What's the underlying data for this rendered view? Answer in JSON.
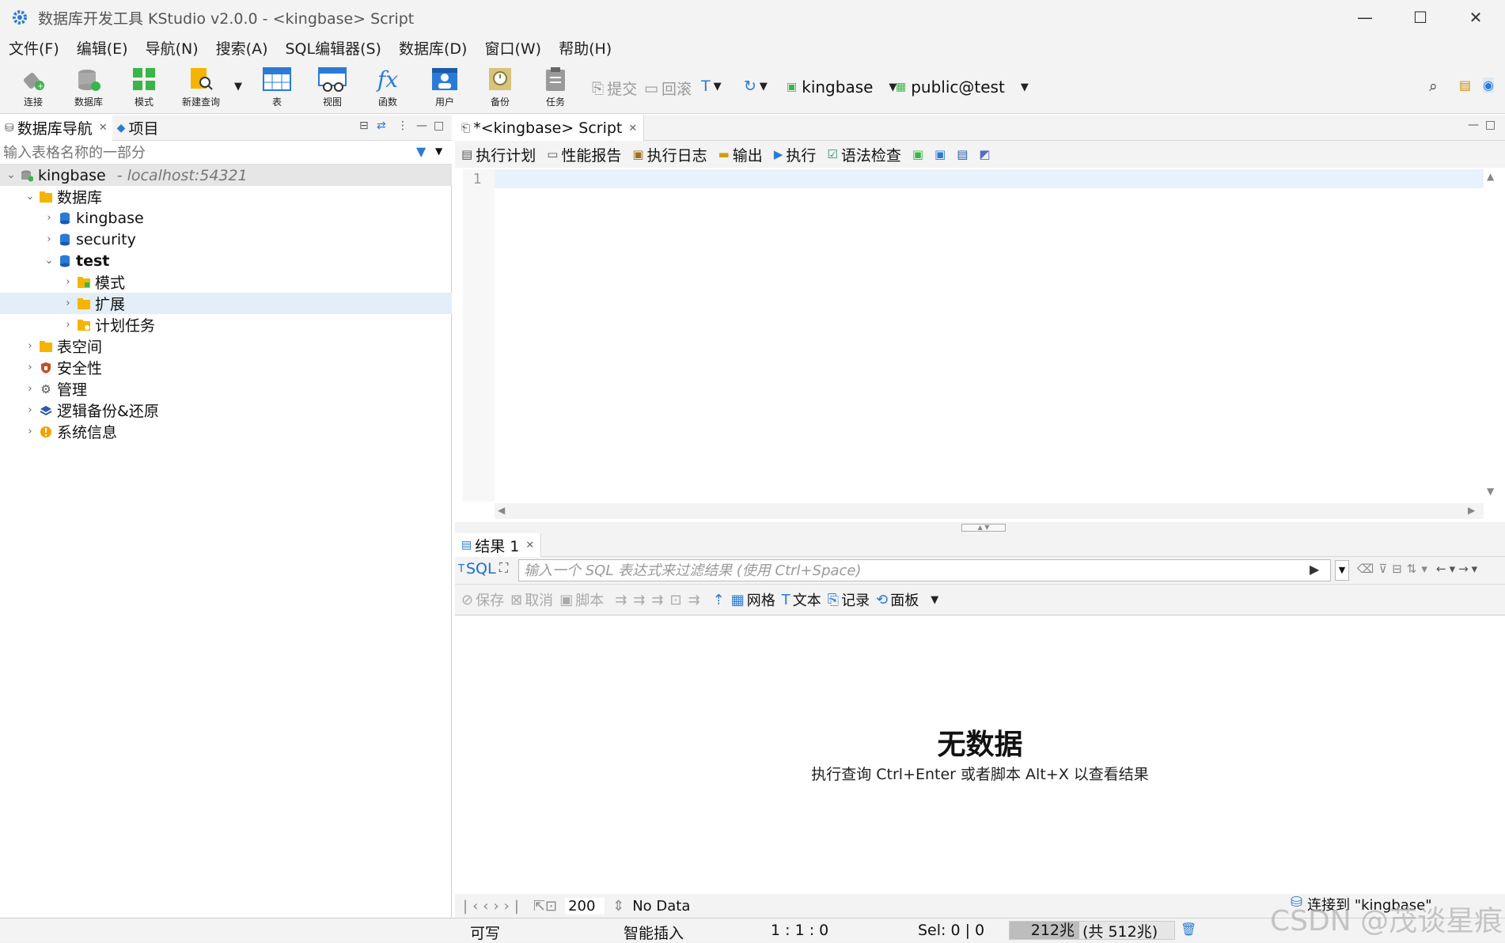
{
  "window": {
    "title": "数据库开发工具 KStudio v2.0.0 - <kingbase> Script",
    "minimize": "—",
    "maximize": "☐",
    "close": "✕"
  },
  "menu": [
    "文件(F)",
    "编辑(E)",
    "导航(N)",
    "搜索(A)",
    "SQL编辑器(S)",
    "数据库(D)",
    "窗口(W)",
    "帮助(H)"
  ],
  "toolbar": {
    "buttons": [
      "连接",
      "数据库",
      "模式",
      "新建查询",
      "表",
      "视图",
      "函数",
      "用户",
      "备份",
      "任务"
    ],
    "commit": "提交",
    "rollback": "回滚",
    "connection": "kingbase",
    "schema": "public@test"
  },
  "left_panel": {
    "tabs": [
      "数据库导航",
      "项目"
    ],
    "filter_placeholder": "输入表格名称的一部分",
    "tree": [
      {
        "label": "kingbase",
        "host": "- localhost:54321"
      },
      {
        "label": "数据库"
      },
      {
        "label": "kingbase"
      },
      {
        "label": "security"
      },
      {
        "label": "test"
      },
      {
        "label": "模式"
      },
      {
        "label": "扩展"
      },
      {
        "label": "计划任务"
      },
      {
        "label": "表空间"
      },
      {
        "label": "安全性"
      },
      {
        "label": "管理"
      },
      {
        "label": "逻辑备份&还原"
      },
      {
        "label": "系统信息"
      }
    ]
  },
  "editor": {
    "tab": "*<kingbase> Script",
    "toolbar": [
      "执行计划",
      "性能报告",
      "执行日志",
      "输出",
      "执行",
      "语法检查"
    ],
    "line_number": "1"
  },
  "results": {
    "tab": "结果 1",
    "sql_label": "SQL",
    "filter_placeholder": "输入一个 SQL 表达式来过滤结果 (使用 Ctrl+Space)",
    "toolbar": [
      "保存",
      "取消",
      "脚本",
      "网格",
      "文本",
      "记录",
      "面板"
    ],
    "no_data_title": "无数据",
    "no_data_hint": "执行查询 Ctrl+Enter 或者脚本 Alt+X 以查看结果",
    "fetch_size": "200",
    "row_status": "No Data",
    "connected_to": "连接到 \"kingbase\""
  },
  "statusbar": {
    "writable": "可写",
    "insert_mode": "智能插入",
    "position": "1 : 1 : 0",
    "selection": "Sel: 0 | 0",
    "heap_used": "212兆",
    "heap_total": "(共 512兆)"
  },
  "watermark": "CSDN @茂谈星痕",
  "colors": {
    "accent": "#1a6fd0",
    "selection": "#e3eef9",
    "folder": "#f5b400"
  }
}
